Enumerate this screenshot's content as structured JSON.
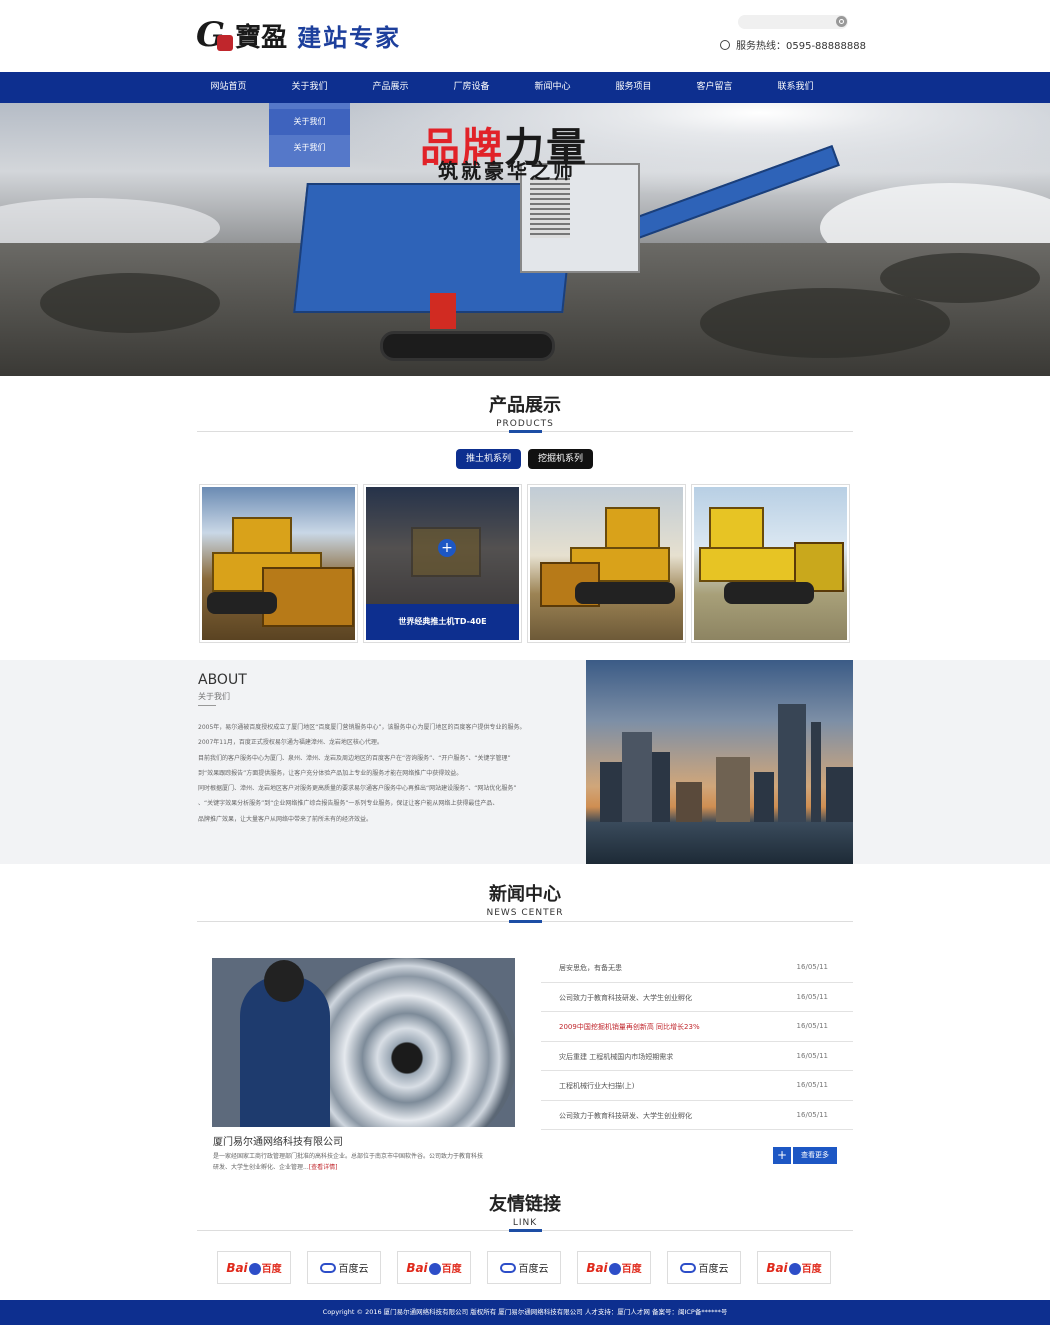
{
  "header": {
    "logo_letter": "G",
    "logo_char": "寶",
    "logo_char2": "盈",
    "logo_text": "建站专家",
    "hotline": "服务热线：0595-88888888"
  },
  "nav": {
    "items": [
      "网站首页",
      "关于我们",
      "产品展示",
      "厂房设备",
      "新闻中心",
      "服务项目",
      "客户留言",
      "联系我们"
    ],
    "dropdown": [
      "关于我们",
      "关于我们"
    ]
  },
  "banner": {
    "slogan_red": "品牌",
    "slogan_dark": "力量",
    "slogan_sub": "筑就豪华之师"
  },
  "products": {
    "title": "产品展示",
    "title_en": "PRODUCTS",
    "tabs": [
      "推土机系列",
      "挖掘机系列"
    ],
    "hover_caption": "世界经典推土机TD-40E"
  },
  "about": {
    "title": "ABOUT",
    "subtitle": "关于我们",
    "lines": [
      "2005年，易尔通被百度授权成立了厦门地区“百度厦门营销服务中心”，该服务中心为厦门地区的百度客户提供专业的服务。",
      "2007年11月，百度正式授权易尔通为福建漳州、龙岩地区核心代理。",
      "目前我们的客户服务中心为厦门、泉州、漳州、龙岩及周边地区的百度客户在“咨询服务”、“开户服务”、“关键字管理”",
      "到“效果跟踪报告”方面提供服务，让客户充分体验产品加上专业的服务才能在网络推广中获得效益。",
      "同时根据厦门、漳州、龙岩地区客户对服务更高质量的要求易尔通客户服务中心再推出“网站建设服务”、“网站优化服务”",
      "、“关键字效果分析服务”到“企业网络推广综合报告服务”一系列专业服务，保证让客户能从网络上获得最佳产品、",
      "品牌推广效果，让大量客户从网络中带来了前所未有的经济效益。"
    ]
  },
  "news": {
    "title": "新闻中心",
    "title_en": "NEWS CENTER",
    "company": "厦门易尔通网络科技有限公司",
    "company_desc": "是一家经国家工商行政管理部门批准的高科技企业。总部位于南京市中国软件谷。公司致力于教育科技研发、大学生创业孵化、企业管理...",
    "company_more": "[查看详情]",
    "items": [
      {
        "title": "居安思危，有备无患",
        "date": "16/05/11"
      },
      {
        "title": "公司致力于教育科技研发、大学生创业孵化",
        "date": "16/05/11"
      },
      {
        "title": "2009中国挖掘机销量再创新高 同比增长23%",
        "date": "16/05/11"
      },
      {
        "title": "灾后重建 工程机械国内市场短期需求",
        "date": "16/05/11"
      },
      {
        "title": "工程机械行业大扫描(上)",
        "date": "16/05/11"
      },
      {
        "title": "公司致力于教育科技研发、大学生创业孵化",
        "date": "16/05/11"
      }
    ],
    "more_plus": "+",
    "more_label": "查看更多"
  },
  "links": {
    "title": "友情链接",
    "title_en": "LINK",
    "baidu_bai": "Bai",
    "baidu_du": "百度",
    "baiduyun": "百度云"
  },
  "footer": {
    "copyright": "Copyright © 2016 厦门易尔通网络科技有限公司 版权所有 厦门易尔通网络科技有限公司 人才支持：厦门人才网 备案号：闽ICP备******号"
  },
  "colors": {
    "nav": "#0d2f8f",
    "accent": "#1d4ea5",
    "highlight": "#c0262c"
  }
}
